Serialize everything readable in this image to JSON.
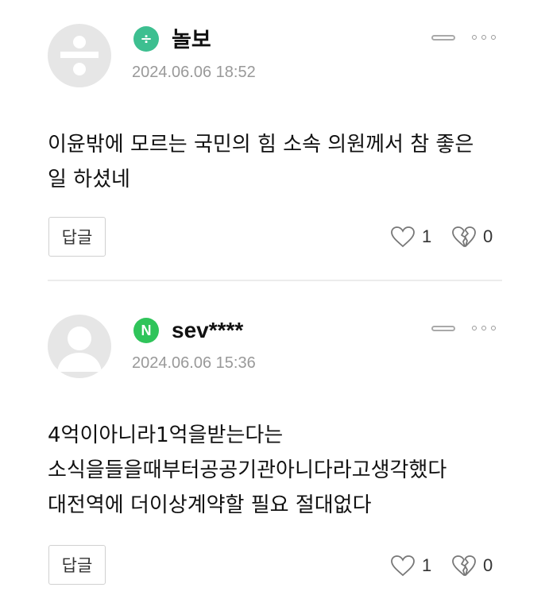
{
  "comments": [
    {
      "avatar_icon": "division-symbol-icon",
      "badge_icon": "division-symbol-icon",
      "badge_text": "÷",
      "nickname": "놀보",
      "date": "2024.06.06 18:52",
      "content_lines": [
        "이윤밖에 모르는 국민의 힘 소속 의원께서 참 좋은",
        "일 하셨네"
      ],
      "reply_label": "답글",
      "likes": "1",
      "dislikes": "0"
    },
    {
      "avatar_icon": "default-user-icon",
      "badge_icon": "naver-n-icon",
      "badge_text": "N",
      "nickname": "sev****",
      "date": "2024.06.06 15:36",
      "content_lines": [
        "4억이아니라1억을받는다는",
        "소식을들을때부터공공기관아니다라고생각했다",
        "대전역에 더이상계약할 필요 절대없다"
      ],
      "reply_label": "답글",
      "likes": "1",
      "dislikes": "0"
    }
  ]
}
